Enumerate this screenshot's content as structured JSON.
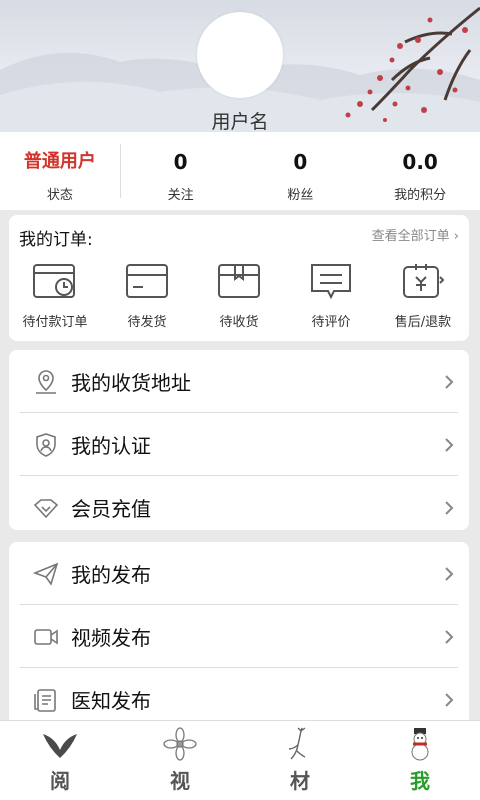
{
  "profile": {
    "username": "用户名"
  },
  "stats": [
    {
      "value": "普通用户",
      "label": "状态"
    },
    {
      "value": "0",
      "label": "关注"
    },
    {
      "value": "0",
      "label": "粉丝"
    },
    {
      "value": "0.0",
      "label": "我的积分"
    }
  ],
  "orders": {
    "title": "我的订单:",
    "view_all": "查看全部订单 ›",
    "items": [
      {
        "label": "待付款订单",
        "icon": "wallet-clock-icon"
      },
      {
        "label": "待发货",
        "icon": "card-icon"
      },
      {
        "label": "待收货",
        "icon": "package-icon"
      },
      {
        "label": "待评价",
        "icon": "comment-icon"
      },
      {
        "label": "售后/退款",
        "icon": "refund-icon"
      }
    ]
  },
  "menu1": [
    {
      "label": "我的收货地址",
      "icon": "location-icon"
    },
    {
      "label": "我的认证",
      "icon": "shield-user-icon"
    },
    {
      "label": "会员充值",
      "icon": "diamond-icon"
    }
  ],
  "menu2": [
    {
      "label": "我的发布",
      "icon": "send-icon"
    },
    {
      "label": "视频发布",
      "icon": "video-icon"
    },
    {
      "label": "医知发布",
      "icon": "document-icon"
    }
  ],
  "tabs": [
    {
      "label": "阅",
      "icon": "leaf-icon",
      "active": false
    },
    {
      "label": "视",
      "icon": "flower-icon",
      "active": false
    },
    {
      "label": "材",
      "icon": "herb-root-icon",
      "active": false
    },
    {
      "label": "我",
      "icon": "snowman-icon",
      "active": true
    }
  ],
  "colors": {
    "accent_red": "#d0342c",
    "active_tab": "#2a9a2a"
  }
}
